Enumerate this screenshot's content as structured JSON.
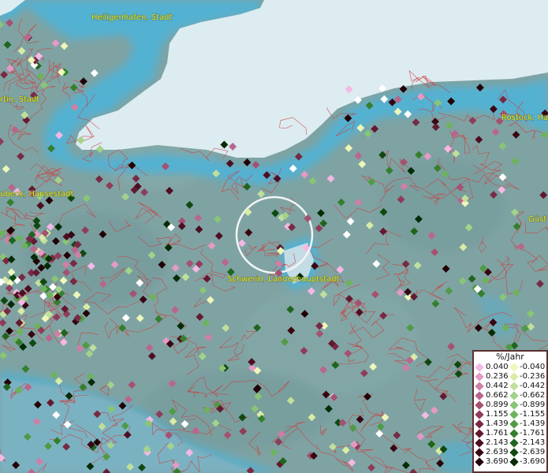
{
  "map": {
    "colors": {
      "land": "#7fa3a3",
      "sea": "#dcecf1",
      "coast_glow": "#59b6d8",
      "borders": "#d23a3a",
      "focus_ring": "#f2f5f5"
    },
    "cities": [
      {
        "name": "Heiligenhafen, Stadt"
      },
      {
        "name": "rtin, Stadt"
      },
      {
        "name": "Rostock, Ha"
      },
      {
        "name": "ubeck, Hansestadt"
      },
      {
        "name": "Schwerin, Landeshauptstadt"
      },
      {
        "name": "Güst"
      }
    ]
  },
  "legend": {
    "title": "%/Jahr",
    "rows": [
      {
        "pos": "0.040",
        "neg": "-0.040",
        "pos_color": "#f4b8e4",
        "neg_color": "#eef7b9"
      },
      {
        "pos": "0.236",
        "neg": "-0.236",
        "pos_color": "#e49ac4",
        "neg_color": "#d8eca6"
      },
      {
        "pos": "0.442",
        "neg": "-0.442",
        "pos_color": "#cf7fa6",
        "neg_color": "#bfe09b"
      },
      {
        "pos": "0.662",
        "neg": "-0.662",
        "pos_color": "#b9668c",
        "neg_color": "#a3d38a"
      },
      {
        "pos": "0.899",
        "neg": "-0.899",
        "pos_color": "#a55171",
        "neg_color": "#88c575"
      },
      {
        "pos": "1.155",
        "neg": "-1.155",
        "pos_color": "#8e3c5a",
        "neg_color": "#6db25d"
      },
      {
        "pos": "1.439",
        "neg": "-1.439",
        "pos_color": "#782a45",
        "neg_color": "#509a45"
      },
      {
        "pos": "1.761",
        "neg": "-1.761",
        "pos_color": "#631a31",
        "neg_color": "#347f2e"
      },
      {
        "pos": "2.143",
        "neg": "-2.143",
        "pos_color": "#4d0e22",
        "neg_color": "#1f651e"
      },
      {
        "pos": "2.639",
        "neg": "-2.639",
        "pos_color": "#380612",
        "neg_color": "#0f4910"
      },
      {
        "pos": "3.690",
        "neg": "-3.690",
        "pos_color": "#220006",
        "neg_color": "#042c05"
      }
    ]
  }
}
